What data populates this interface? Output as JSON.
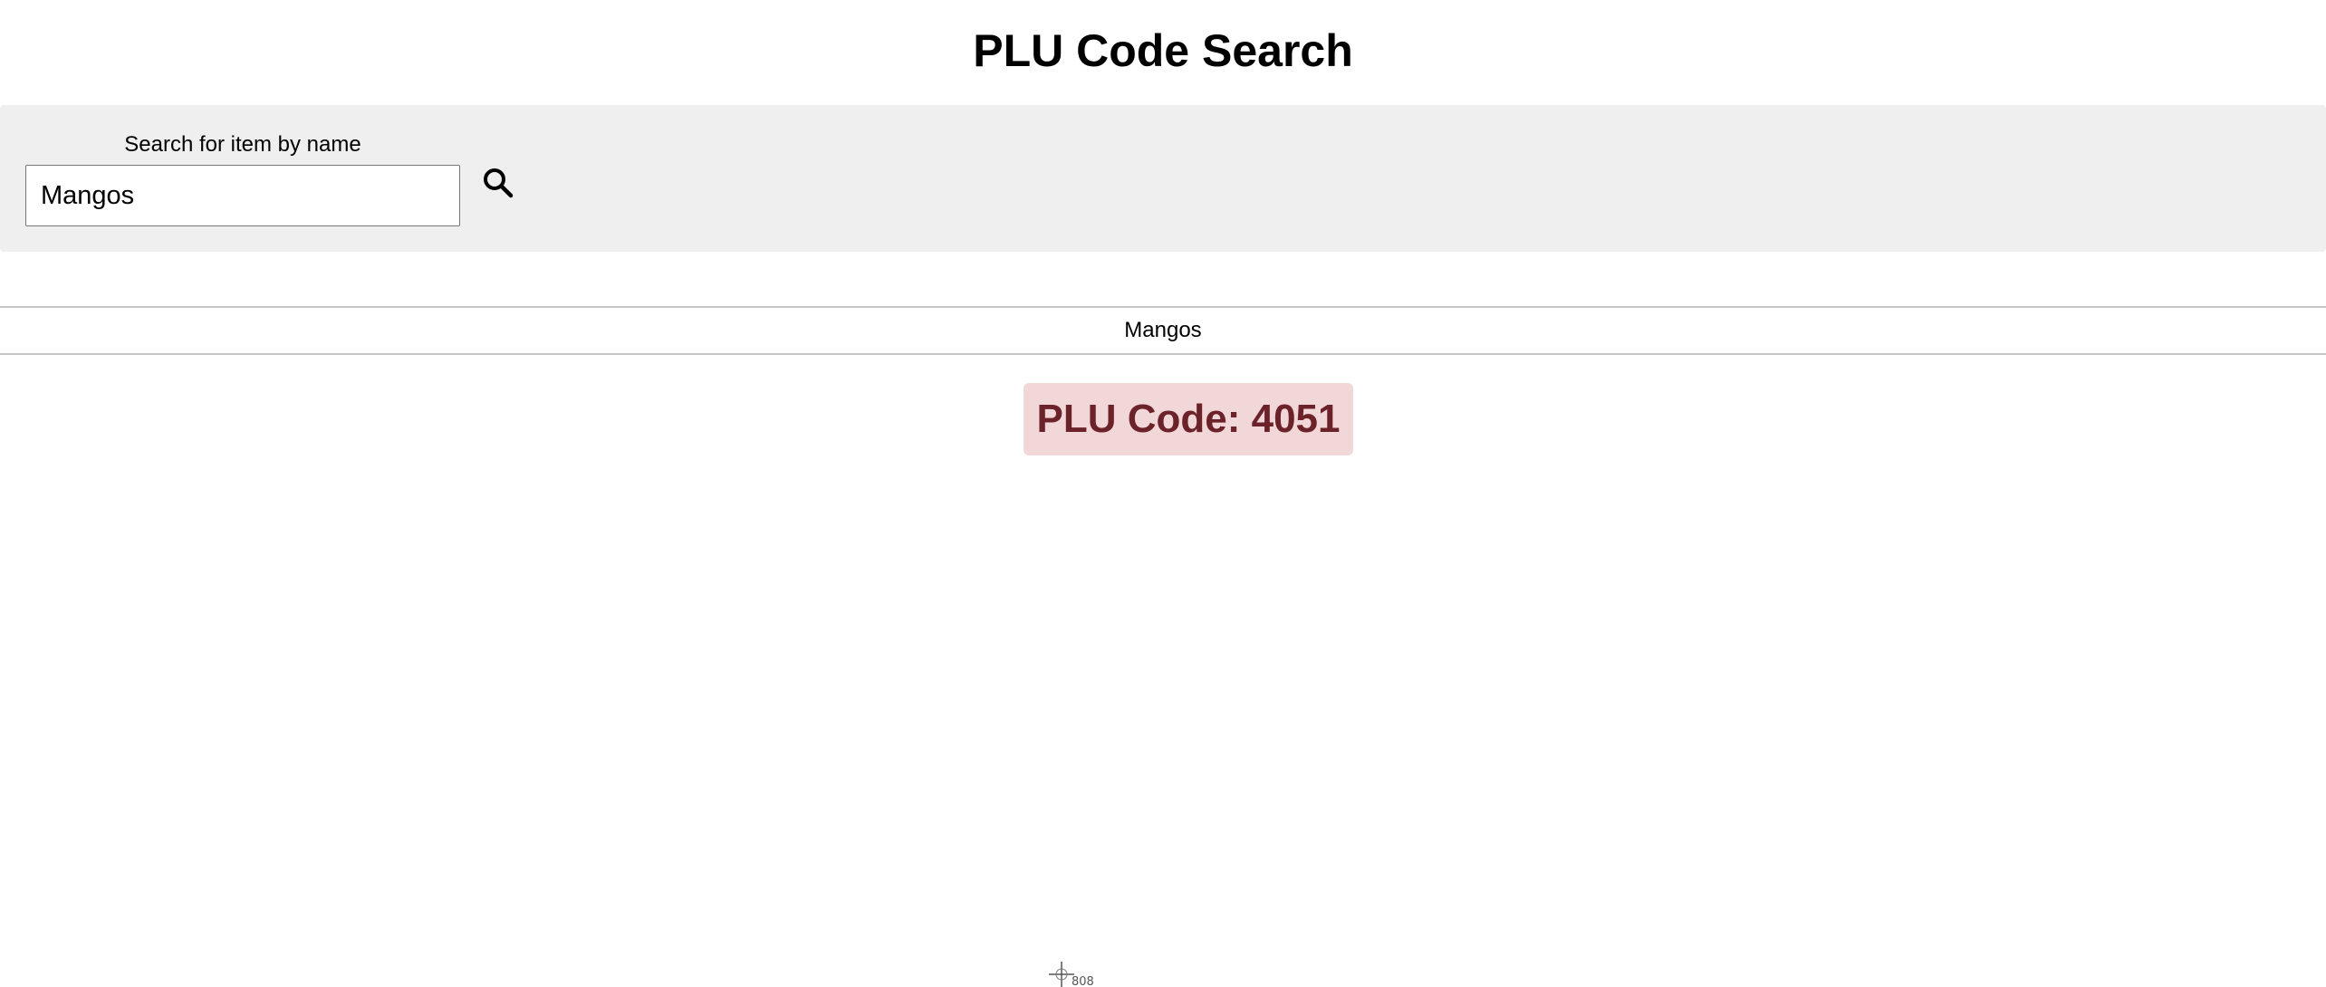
{
  "header": {
    "title": "PLU Code Search"
  },
  "search": {
    "label": "Search for item by name",
    "value": "Mangos",
    "placeholder": "",
    "button_icon": "search-icon"
  },
  "results": {
    "items": [
      {
        "name": "Mangos"
      }
    ]
  },
  "plu": {
    "text": "PLU Code: 4051",
    "background_color": "#f2d7d9",
    "text_color": "#6b2229"
  },
  "cursor": {
    "icon": "crosshair-cursor-icon",
    "label": "808"
  }
}
